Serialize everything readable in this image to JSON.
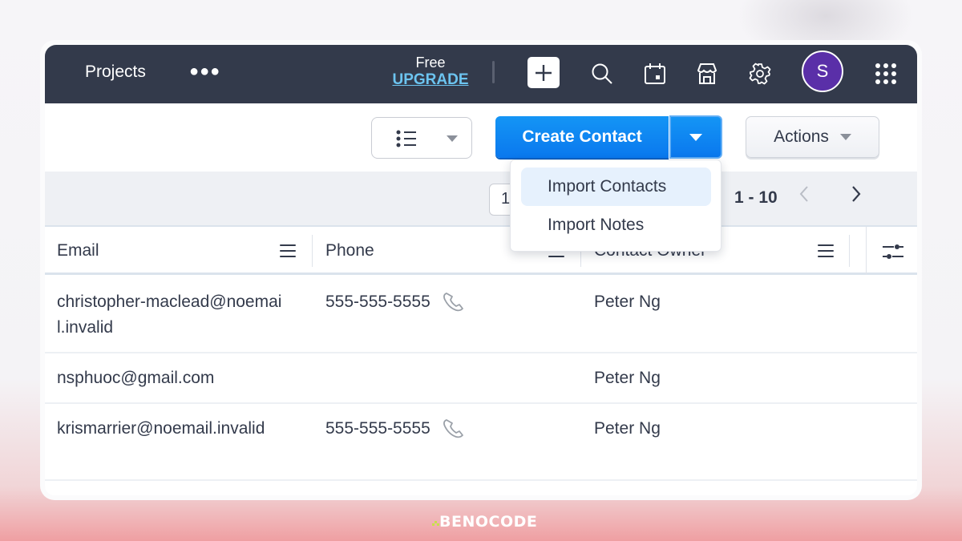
{
  "topbar": {
    "title": "Projects",
    "more_icon": "more-horizontal-icon",
    "plan_label": "Free",
    "upgrade_label": "UPGRADE",
    "icons": [
      "plus-icon",
      "search-icon",
      "calendar-icon",
      "store-icon",
      "gear-icon",
      "apps-grid-icon"
    ],
    "avatar_initial": "S",
    "avatar_color": "#5a2fa8",
    "bar_color": "#333a4b",
    "upgrade_color": "#6cc4f0"
  },
  "toolbar": {
    "view_icon": "list-view-icon",
    "create_label": "Create Contact",
    "create_color": "#0a78ee",
    "actions_label": "Actions"
  },
  "create_menu": {
    "items": [
      {
        "label": "Import Contacts",
        "active": true
      },
      {
        "label": "Import Notes",
        "active": false
      }
    ]
  },
  "pagination": {
    "page_size": "1",
    "range": "1 - 10",
    "prev": "‹",
    "next": "›"
  },
  "table": {
    "columns": [
      "Email",
      "Phone",
      "Contact Owner"
    ],
    "rows": [
      {
        "email": "christopher-maclead@noemail.invalid",
        "phone": "555-555-5555",
        "owner": "Peter Ng"
      },
      {
        "email": "nsphuoc@gmail.com",
        "phone": "",
        "owner": "Peter Ng"
      },
      {
        "email": "krismarrier@noemail.invalid",
        "phone": "555-555-5555",
        "owner": "Peter Ng"
      }
    ]
  },
  "watermark": "BENOCODE"
}
